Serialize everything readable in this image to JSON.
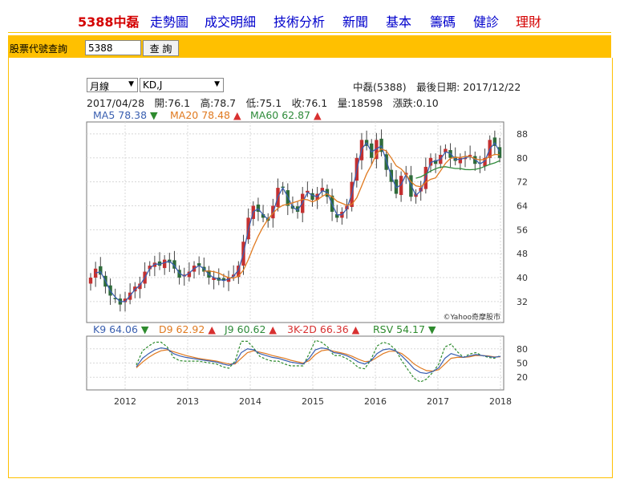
{
  "nav": {
    "brand": "5388中磊",
    "items": [
      "走勢圖",
      "成交明細",
      "技術分析",
      "新聞",
      "基本",
      "籌碼",
      "健診",
      "理財"
    ]
  },
  "query": {
    "label": "股票代號查詢",
    "value": "5388",
    "button": "查 詢"
  },
  "controls": {
    "period": "月線",
    "indicator": "KD,J"
  },
  "header": {
    "title": "中磊(5388)　最後日期: 2017/12/22",
    "ohlc": "2017/04/28　開:76.1　高:78.7　低:75.1　收:76.1　量:18598　漲跌:0.10"
  },
  "ma_legend": [
    {
      "label": "MA5 78.38",
      "arrow": "▼",
      "color": "#3a5fb0",
      "arrow_color": "#2e8b2e"
    },
    {
      "label": "MA20 78.48",
      "arrow": "▲",
      "color": "#e07a20",
      "arrow_color": "#d83030"
    },
    {
      "label": "MA60 62.87",
      "arrow": "▲",
      "color": "#2e8b3a",
      "arrow_color": "#d83030"
    }
  ],
  "ind_legend": [
    {
      "label": "K9 64.06",
      "arrow": "▼",
      "color": "#3a5fb0",
      "arrow_color": "#2e8b2e"
    },
    {
      "label": "D9 62.92",
      "arrow": "▲",
      "color": "#e07a20",
      "arrow_color": "#d83030"
    },
    {
      "label": "J9 60.62",
      "arrow": "▲",
      "color": "#2e8b3a",
      "arrow_color": "#d83030"
    },
    {
      "label": "3K-2D 66.36",
      "arrow": "▲",
      "color": "#d83030",
      "arrow_color": "#d83030"
    },
    {
      "label": "RSV 54.17",
      "arrow": "▼",
      "color": "#2e8b2e",
      "arrow_color": "#2e8b2e"
    }
  ],
  "watermark": "©Yahoo奇摩股市",
  "chart_data": {
    "type": "candlestick",
    "price_axis": {
      "ticks": [
        32,
        40,
        48,
        56,
        64,
        72,
        80,
        88
      ],
      "ylim": [
        25,
        92
      ]
    },
    "kd_axis": {
      "ticks": [
        20,
        50,
        80
      ],
      "ylim": [
        0,
        100
      ]
    },
    "x_ticks": [
      "2012",
      "2013",
      "2014",
      "2015",
      "2016",
      "2017",
      "2018"
    ],
    "colors": {
      "up": "#c43030",
      "down": "#2e6b3a",
      "ma5": "#3a5fb0",
      "ma20": "#e07a20",
      "ma60": "#2e8b3a",
      "k": "#3a5fb0",
      "d": "#e07a20",
      "j": "#2e8b2e"
    },
    "close": [
      40,
      43,
      41,
      37,
      34,
      33,
      31,
      33,
      35,
      37,
      38,
      42,
      44,
      45,
      44,
      46,
      45,
      43,
      40,
      41,
      42,
      44,
      44,
      42,
      40,
      40,
      39,
      39,
      40,
      41,
      44,
      52,
      60,
      64,
      62,
      60,
      59,
      64,
      70,
      70,
      64,
      63,
      62,
      68,
      69,
      66,
      68,
      70,
      67,
      62,
      60,
      62,
      64,
      72,
      80,
      86,
      84,
      80,
      86,
      82,
      76,
      72,
      68,
      74,
      75,
      67,
      68,
      70,
      77,
      80,
      78,
      81,
      83,
      80,
      79,
      80,
      80,
      81,
      78,
      78,
      80,
      86,
      84,
      80
    ],
    "k": [
      42,
      60,
      70,
      78,
      82,
      80,
      70,
      65,
      62,
      60,
      58,
      56,
      54,
      52,
      48,
      45,
      50,
      72,
      80,
      78,
      70,
      66,
      62,
      60,
      56,
      52,
      50,
      48,
      60,
      78,
      82,
      80,
      72,
      70,
      66,
      60,
      52,
      48,
      55,
      70,
      78,
      80,
      76,
      65,
      52,
      38,
      30,
      28,
      32,
      40,
      60,
      70,
      66,
      62,
      65,
      68,
      66,
      64,
      62,
      64
    ],
    "d": [
      40,
      52,
      62,
      70,
      76,
      78,
      74,
      70,
      66,
      63,
      60,
      58,
      56,
      54,
      51,
      48,
      48,
      60,
      72,
      76,
      73,
      70,
      66,
      63,
      60,
      56,
      53,
      50,
      55,
      68,
      76,
      78,
      75,
      72,
      69,
      64,
      58,
      53,
      54,
      62,
      70,
      75,
      75,
      70,
      60,
      48,
      40,
      34,
      33,
      36,
      48,
      60,
      62,
      62,
      63,
      66,
      66,
      65,
      63,
      63
    ],
    "j": [
      46,
      76,
      86,
      94,
      94,
      84,
      62,
      55,
      54,
      54,
      54,
      52,
      50,
      48,
      42,
      39,
      54,
      96,
      96,
      82,
      64,
      58,
      54,
      54,
      48,
      44,
      44,
      44,
      70,
      98,
      94,
      84,
      66,
      66,
      60,
      52,
      40,
      38,
      57,
      86,
      94,
      90,
      78,
      55,
      36,
      18,
      10,
      16,
      30,
      48,
      84,
      90,
      74,
      62,
      69,
      72,
      66,
      62,
      60,
      66
    ]
  }
}
